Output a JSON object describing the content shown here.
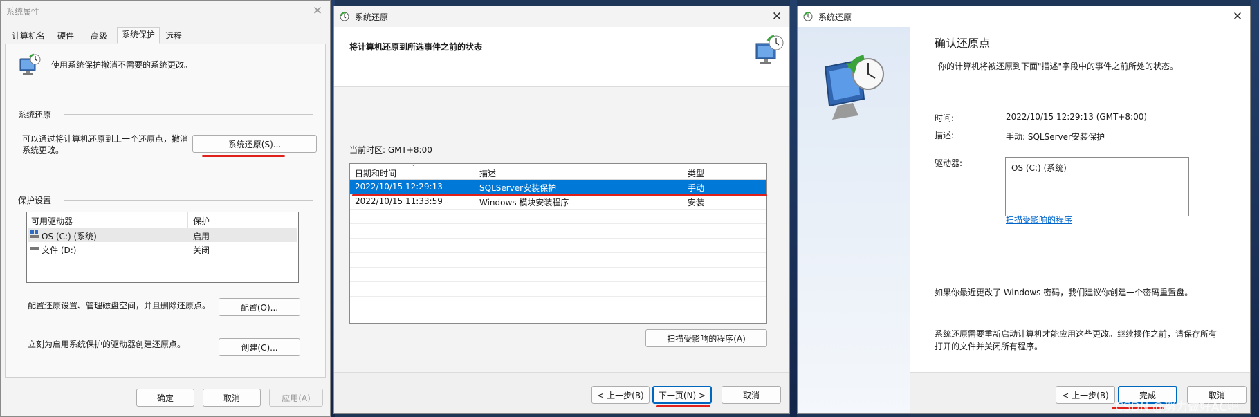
{
  "win1": {
    "title": "系统属性",
    "tabs": [
      "计算机名",
      "硬件",
      "高级",
      "系统保护",
      "远程"
    ],
    "intro": "使用系统保护撤消不需要的系统更改。",
    "restore_group": "系统还原",
    "restore_desc_l1": "可以通过将计算机还原到上一个还原点，撤消",
    "restore_desc_l2": "系统更改。",
    "restore_button": "系统还原(S)...",
    "protect_group": "保护设置",
    "col_drive": "可用驱动器",
    "col_protect": "保护",
    "drives": [
      {
        "name": "OS (C:) (系统)",
        "status": "启用"
      },
      {
        "name": "文件 (D:)",
        "status": "关闭"
      }
    ],
    "config_desc": "配置还原设置、管理磁盘空间，并且删除还原点。",
    "config_button": "配置(O)...",
    "create_desc": "立刻为启用系统保护的驱动器创建还原点。",
    "create_button": "创建(C)...",
    "ok": "确定",
    "cancel": "取消",
    "apply": "应用(A)"
  },
  "win2": {
    "title": "系统还原",
    "heading": "将计算机还原到所选事件之前的状态",
    "timezone": "当前时区: GMT+8:00",
    "col_date": "日期和时间",
    "col_desc": "描述",
    "col_type": "类型",
    "rows": [
      {
        "date": "2022/10/15 12:29:13",
        "desc": "SQLServer安装保护",
        "type": "手动"
      },
      {
        "date": "2022/10/15 11:33:59",
        "desc": "Windows 模块安装程序",
        "type": "安装"
      }
    ],
    "scan_button": "扫描受影响的程序(A)",
    "back": "< 上一步(B)",
    "next": "下一页(N) >",
    "cancel": "取消"
  },
  "win3": {
    "title": "系统还原",
    "heading": "确认还原点",
    "subtitle": "你的计算机将被还原到下面\"描述\"字段中的事件之前所处的状态。",
    "time_label": "时间:",
    "time_value": "2022/10/15 12:29:13 (GMT+8:00)",
    "desc_label": "描述:",
    "desc_value": "手动: SQLServer安装保护",
    "drive_label": "驱动器:",
    "drive_value": "OS (C:) (系统)",
    "scan_link": "扫描受影响的程序",
    "password_note": "如果你最近更改了 Windows 密码，我们建议你创建一个密码重置盘。",
    "restart_note_l1": "系统还原需要重新启动计算机才能应用这些更改。继续操作之前，请保存所有",
    "restart_note_l2": "打开的文件并关闭所有程序。",
    "back": "< 上一步(B)",
    "finish": "完成",
    "cancel": "取消"
  },
  "watermark": "CSDN @努力做好AC吧",
  "colors": {
    "selection": "#0078d7",
    "annotation": "#e0201b",
    "link": "#0066cc"
  }
}
